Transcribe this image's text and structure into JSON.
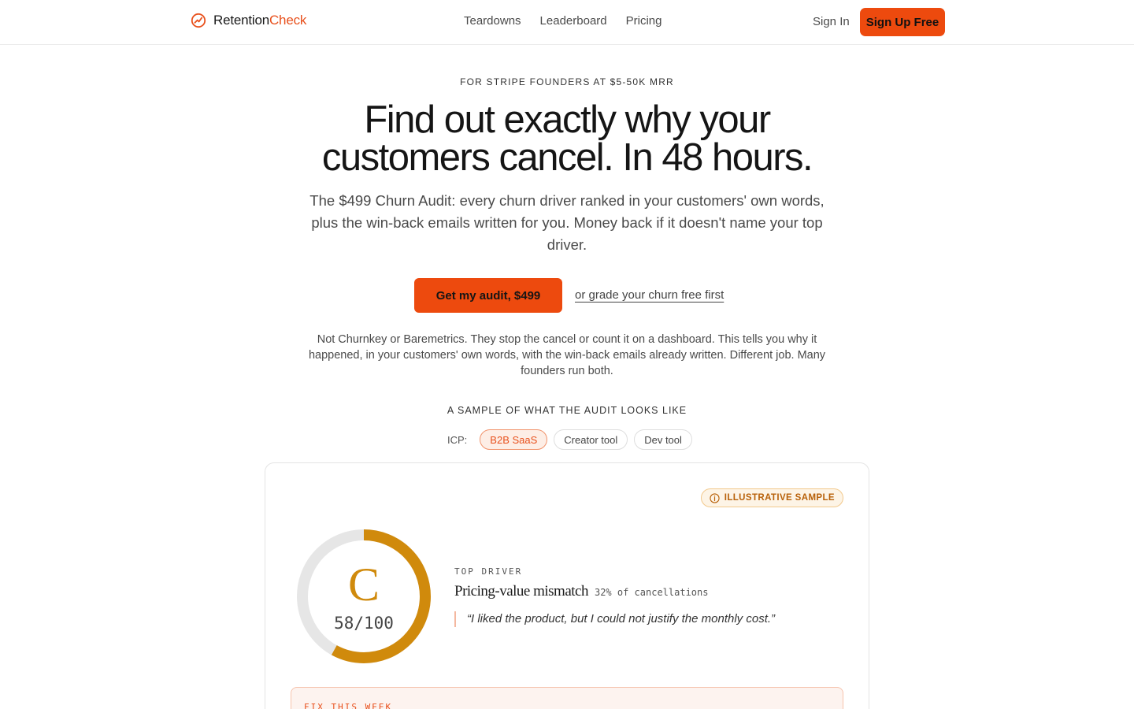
{
  "brand": {
    "name": "Retention",
    "accent": "Check",
    "accent_color": "#e8501c",
    "icon": "chart-circle-icon"
  },
  "nav": {
    "items": [
      "Teardowns",
      "Leaderboard",
      "Pricing"
    ]
  },
  "auth": {
    "sign_in": "Sign In",
    "sign_up": "Sign Up Free"
  },
  "hero": {
    "eyebrow": "FOR STRIPE FOUNDERS AT $5-50K MRR",
    "headline": "Find out exactly why your customers cancel. In 48 hours.",
    "subhead": "The $499 Churn Audit: every churn driver ranked in your customers' own words, plus the win-back emails written for you. Money back if it doesn't name your top driver.",
    "cta_primary": "Get my audit, $499",
    "cta_secondary": "or grade your churn free first",
    "disclaimer": "Not Churnkey or Baremetrics. They stop the cancel or count it on a dashboard. This tells you why it happened, in your customers' own words, with the win-back emails already written. Different job. Many founders run both."
  },
  "sample": {
    "label": "A SAMPLE OF WHAT THE AUDIT LOOKS LIKE",
    "icp_label": "ICP:",
    "icp_options": [
      "B2B SaaS",
      "Creator tool",
      "Dev tool"
    ],
    "icp_selected": "B2B SaaS"
  },
  "card": {
    "badge": "ILLUSTRATIVE SAMPLE",
    "badge_icon": "info-icon",
    "grade": "C",
    "score": "58/100",
    "score_value": 58,
    "score_max": 100,
    "gauge_color": "#d08a0c",
    "track_color": "#e6e6e6",
    "driver_label": "TOP DRIVER",
    "driver_title": "Pricing-value mismatch",
    "driver_share": "32% of cancellations",
    "driver_quote": "“I liked the product, but I could not justify the monthly cost.”",
    "fix_label": "FIX THIS WEEK"
  }
}
